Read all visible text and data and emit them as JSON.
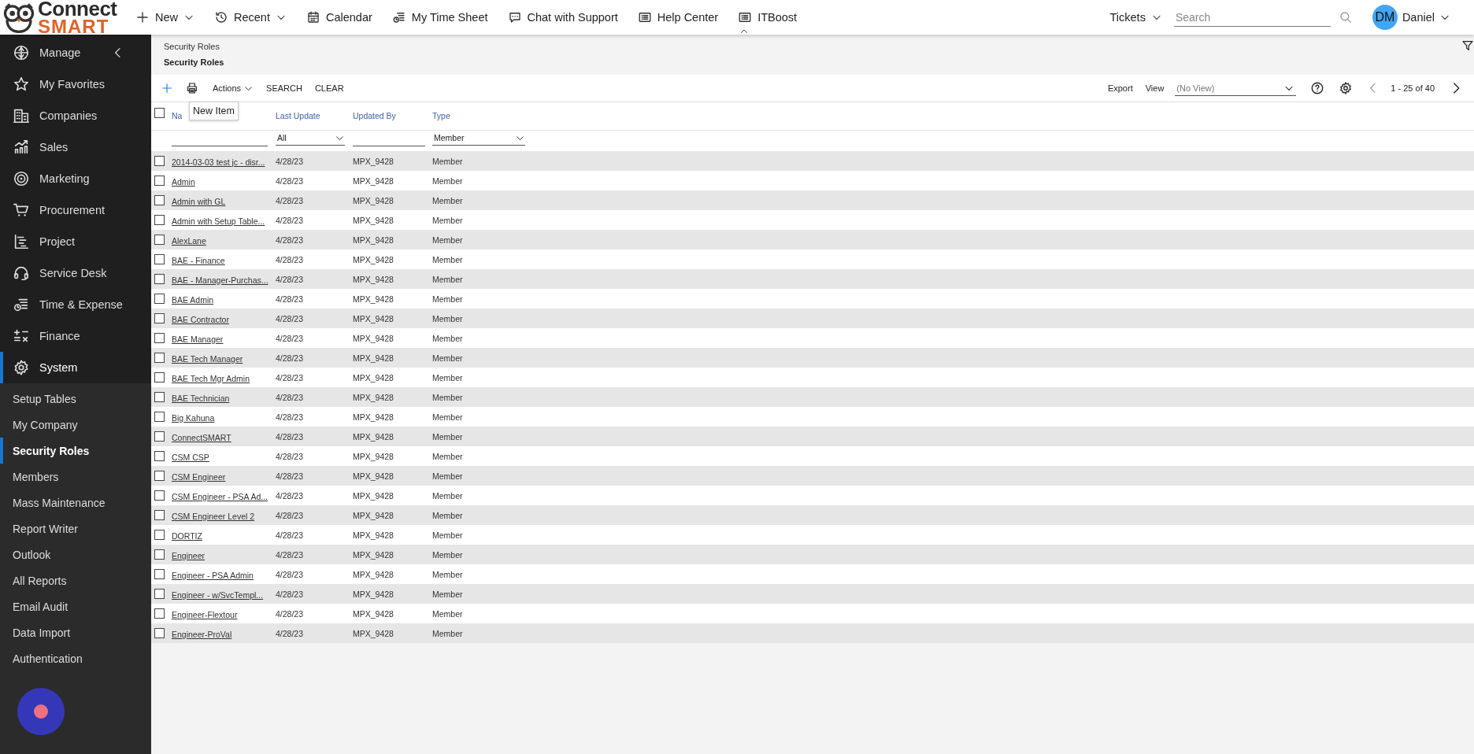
{
  "header": {
    "logo": {
      "line1": "Connect",
      "line2": "SMART"
    },
    "nav": [
      {
        "label": "New",
        "dropdown": true
      },
      {
        "label": "Recent",
        "dropdown": true
      },
      {
        "label": "Calendar",
        "dropdown": false
      },
      {
        "label": "My Time Sheet",
        "dropdown": false
      },
      {
        "label": "Chat with Support",
        "dropdown": false
      },
      {
        "label": "Help Center",
        "dropdown": false
      },
      {
        "label": "ITBoost",
        "dropdown": false
      }
    ],
    "tickets": "Tickets",
    "search": {
      "placeholder": "Search"
    },
    "user": {
      "initials": "DM",
      "name": "Daniel"
    }
  },
  "sidebar": {
    "items": [
      {
        "label": "Manage",
        "selected": false
      },
      {
        "label": "My Favorites",
        "selected": false
      },
      {
        "label": "Companies",
        "selected": false
      },
      {
        "label": "Sales",
        "selected": false
      },
      {
        "label": "Marketing",
        "selected": false
      },
      {
        "label": "Procurement",
        "selected": false
      },
      {
        "label": "Project",
        "selected": false
      },
      {
        "label": "Service Desk",
        "selected": false
      },
      {
        "label": "Time & Expense",
        "selected": false
      },
      {
        "label": "Finance",
        "selected": false
      },
      {
        "label": "System",
        "selected": true
      }
    ],
    "subitems": [
      {
        "label": "Setup Tables",
        "selected": false
      },
      {
        "label": "My Company",
        "selected": false
      },
      {
        "label": "Security Roles",
        "selected": true
      },
      {
        "label": "Members",
        "selected": false
      },
      {
        "label": "Mass Maintenance",
        "selected": false
      },
      {
        "label": "Report Writer",
        "selected": false
      },
      {
        "label": "Outlook",
        "selected": false
      },
      {
        "label": "All Reports",
        "selected": false
      },
      {
        "label": "Email Audit",
        "selected": false
      },
      {
        "label": "Data Import",
        "selected": false
      },
      {
        "label": "Authentication",
        "selected": false
      }
    ]
  },
  "breadcrumb": "Security Roles",
  "page_title": "Security Roles",
  "toolbar": {
    "actions": "Actions",
    "search": "SEARCH",
    "clear": "CLEAR",
    "tooltip": "New Item",
    "export": "Export",
    "view_label": "View",
    "view": "(No View)",
    "pagination": "1 - 25 of 40"
  },
  "table": {
    "select_all_checked": false,
    "columns": [
      "Na",
      "Last Update",
      "Updated By",
      "Type"
    ],
    "filters": [
      {
        "kind": "text"
      },
      {
        "kind": "select",
        "value": "All"
      },
      {
        "kind": "text"
      },
      {
        "kind": "select",
        "value": "Member"
      }
    ],
    "rows": [
      {
        "name": "2014-03-03 test jc - disr...",
        "last_update": "4/28/23",
        "updated_by": "MPX_9428",
        "type": "Member",
        "checked": false
      },
      {
        "name": "Admin",
        "last_update": "4/28/23",
        "updated_by": "MPX_9428",
        "type": "Member",
        "checked": false
      },
      {
        "name": "Admin with GL",
        "last_update": "4/28/23",
        "updated_by": "MPX_9428",
        "type": "Member",
        "checked": false
      },
      {
        "name": "Admin with Setup Table...",
        "last_update": "4/28/23",
        "updated_by": "MPX_9428",
        "type": "Member",
        "checked": false
      },
      {
        "name": "AlexLane",
        "last_update": "4/28/23",
        "updated_by": "MPX_9428",
        "type": "Member",
        "checked": false
      },
      {
        "name": "BAE - Finance",
        "last_update": "4/28/23",
        "updated_by": "MPX_9428",
        "type": "Member",
        "checked": false
      },
      {
        "name": "BAE - Manager-Purchas...",
        "last_update": "4/28/23",
        "updated_by": "MPX_9428",
        "type": "Member",
        "checked": false
      },
      {
        "name": "BAE Admin",
        "last_update": "4/28/23",
        "updated_by": "MPX_9428",
        "type": "Member",
        "checked": false
      },
      {
        "name": "BAE Contractor",
        "last_update": "4/28/23",
        "updated_by": "MPX_9428",
        "type": "Member",
        "checked": false
      },
      {
        "name": "BAE Manager",
        "last_update": "4/28/23",
        "updated_by": "MPX_9428",
        "type": "Member",
        "checked": false
      },
      {
        "name": "BAE Tech Manager",
        "last_update": "4/28/23",
        "updated_by": "MPX_9428",
        "type": "Member",
        "checked": false
      },
      {
        "name": "BAE Tech Mgr Admin",
        "last_update": "4/28/23",
        "updated_by": "MPX_9428",
        "type": "Member",
        "checked": false
      },
      {
        "name": "BAE Technician",
        "last_update": "4/28/23",
        "updated_by": "MPX_9428",
        "type": "Member",
        "checked": false
      },
      {
        "name": "Big Kahuna",
        "last_update": "4/28/23",
        "updated_by": "MPX_9428",
        "type": "Member",
        "checked": false
      },
      {
        "name": "ConnectSMART",
        "last_update": "4/28/23",
        "updated_by": "MPX_9428",
        "type": "Member",
        "checked": false
      },
      {
        "name": "CSM CSP",
        "last_update": "4/28/23",
        "updated_by": "MPX_9428",
        "type": "Member",
        "checked": false
      },
      {
        "name": "CSM Engineer",
        "last_update": "4/28/23",
        "updated_by": "MPX_9428",
        "type": "Member",
        "checked": false
      },
      {
        "name": "CSM Engineer - PSA Ad...",
        "last_update": "4/28/23",
        "updated_by": "MPX_9428",
        "type": "Member",
        "checked": false
      },
      {
        "name": "CSM Engineer Level 2",
        "last_update": "4/28/23",
        "updated_by": "MPX_9428",
        "type": "Member",
        "checked": false
      },
      {
        "name": "DORTIZ",
        "last_update": "4/28/23",
        "updated_by": "MPX_9428",
        "type": "Member",
        "checked": false
      },
      {
        "name": "Engineer",
        "last_update": "4/28/23",
        "updated_by": "MPX_9428",
        "type": "Member",
        "checked": false
      },
      {
        "name": "Engineer - PSA Admin",
        "last_update": "4/28/23",
        "updated_by": "MPX_9428",
        "type": "Member",
        "checked": false
      },
      {
        "name": "Engineer - w/SvcTempl...",
        "last_update": "4/28/23",
        "updated_by": "MPX_9428",
        "type": "Member",
        "checked": false
      },
      {
        "name": "Engineer-Flextour",
        "last_update": "4/28/23",
        "updated_by": "MPX_9428",
        "type": "Member",
        "checked": false
      },
      {
        "name": "Engineer-ProVal",
        "last_update": "4/28/23",
        "updated_by": "MPX_9428",
        "type": "Member",
        "checked": false
      }
    ]
  }
}
